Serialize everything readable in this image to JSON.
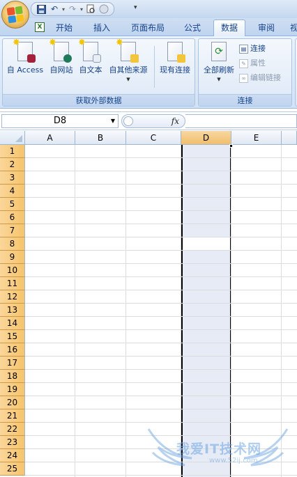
{
  "qat": {
    "undo_icon": "undo-icon",
    "redo_icon": "redo-icon",
    "save_icon": "save-icon",
    "preview_icon": "print-preview-icon"
  },
  "tabs": [
    {
      "label": "开始"
    },
    {
      "label": "插入"
    },
    {
      "label": "页面布局"
    },
    {
      "label": "公式"
    },
    {
      "label": "数据",
      "active": true
    },
    {
      "label": "审阅"
    },
    {
      "label": "视"
    }
  ],
  "ribbon": {
    "get_external": {
      "group_label": "获取外部数据",
      "from_access": "自 Access",
      "from_web": "自网站",
      "from_text": "自文本",
      "from_other": "自其他来源",
      "existing": "现有连接"
    },
    "connections": {
      "group_label": "连接",
      "refresh_all": "全部刷新",
      "connections": "连接",
      "properties": "属性",
      "edit_links": "编辑链接"
    }
  },
  "formula_bar": {
    "name_box": "D8",
    "fx": "fx",
    "value": ""
  },
  "sheet": {
    "columns": [
      "A",
      "B",
      "C",
      "D",
      "E"
    ],
    "selected_column": "D",
    "active_cell": "D8",
    "rows": [
      "1",
      "2",
      "3",
      "4",
      "5",
      "6",
      "7",
      "8",
      "9",
      "10",
      "11",
      "12",
      "13",
      "14",
      "15",
      "16",
      "17",
      "18",
      "19",
      "20",
      "21",
      "22",
      "23",
      "24",
      "25"
    ]
  },
  "watermark": {
    "text": "我爱IT技术网",
    "sub": "www.52ij.com"
  },
  "colors": {
    "accent": "#15428b",
    "tab_bg": "#bfd4ef",
    "row_header": "#f6c46b",
    "selected_col": "#e6ebf5"
  }
}
